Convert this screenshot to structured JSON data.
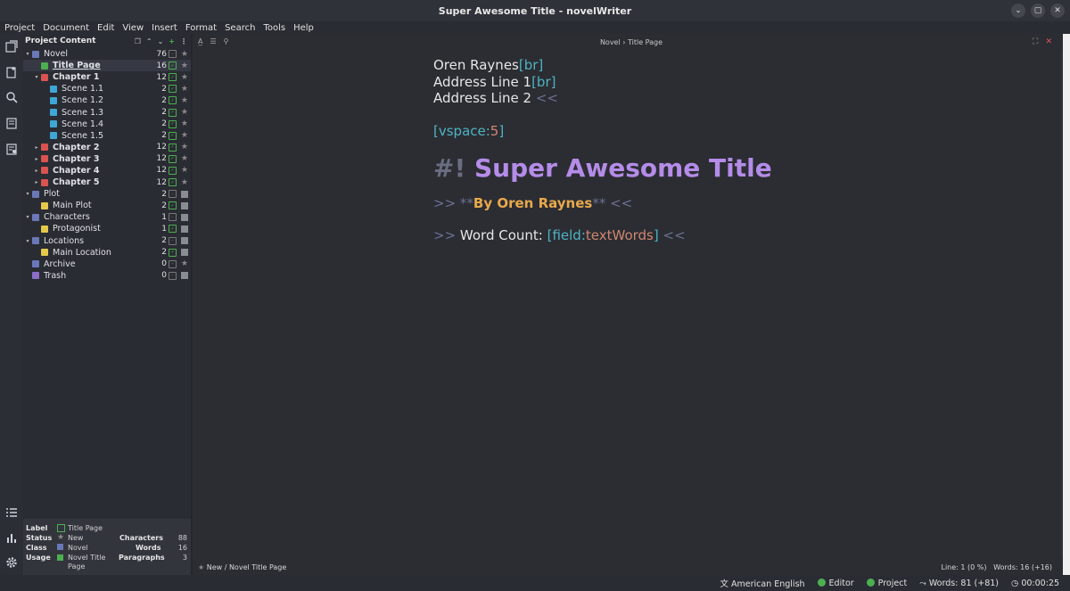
{
  "window": {
    "title": "Super Awesome Title - novelWriter",
    "controls": [
      "chevron-down-icon",
      "maximize-icon",
      "close-icon"
    ]
  },
  "menu": [
    "Project",
    "Document",
    "Edit",
    "View",
    "Insert",
    "Format",
    "Search",
    "Tools",
    "Help"
  ],
  "tree": {
    "header": "Project Content",
    "items": [
      {
        "name": "Novel",
        "count": "76",
        "color": "#6a78b8",
        "indent": 0,
        "bold": false
      },
      {
        "name": "Title Page",
        "count": "16",
        "color": "#4caf50",
        "indent": 1,
        "bold": true,
        "selected": true
      },
      {
        "name": "Chapter 1",
        "count": "12",
        "color": "#d9534f",
        "indent": 1,
        "bold": true
      },
      {
        "name": "Scene 1.1",
        "count": "2",
        "color": "#3fa7d6",
        "indent": 2,
        "bold": false
      },
      {
        "name": "Scene 1.2",
        "count": "2",
        "color": "#3fa7d6",
        "indent": 2,
        "bold": false
      },
      {
        "name": "Scene 1.3",
        "count": "2",
        "color": "#3fa7d6",
        "indent": 2,
        "bold": false
      },
      {
        "name": "Scene 1.4",
        "count": "2",
        "color": "#3fa7d6",
        "indent": 2,
        "bold": false
      },
      {
        "name": "Scene 1.5",
        "count": "2",
        "color": "#3fa7d6",
        "indent": 2,
        "bold": false
      },
      {
        "name": "Chapter 2",
        "count": "12",
        "color": "#d9534f",
        "indent": 1,
        "bold": true
      },
      {
        "name": "Chapter 3",
        "count": "12",
        "color": "#d9534f",
        "indent": 1,
        "bold": true
      },
      {
        "name": "Chapter 4",
        "count": "12",
        "color": "#d9534f",
        "indent": 1,
        "bold": true
      },
      {
        "name": "Chapter 5",
        "count": "12",
        "color": "#d9534f",
        "indent": 1,
        "bold": true
      },
      {
        "name": "Plot",
        "count": "2",
        "color": "#6a78b8",
        "indent": 0,
        "bold": false
      },
      {
        "name": "Main Plot",
        "count": "2",
        "color": "#e6c84b",
        "indent": 1,
        "bold": false
      },
      {
        "name": "Characters",
        "count": "1",
        "color": "#6a78b8",
        "indent": 0,
        "bold": false
      },
      {
        "name": "Protagonist",
        "count": "1",
        "color": "#e6c84b",
        "indent": 1,
        "bold": false
      },
      {
        "name": "Locations",
        "count": "2",
        "color": "#6a78b8",
        "indent": 0,
        "bold": false
      },
      {
        "name": "Main Location",
        "count": "2",
        "color": "#e6c84b",
        "indent": 1,
        "bold": false
      },
      {
        "name": "Archive",
        "count": "0",
        "color": "#6a78b8",
        "indent": 0,
        "bold": false
      },
      {
        "name": "Trash",
        "count": "0",
        "color": "#8a6ec8",
        "indent": 0,
        "bold": false
      }
    ]
  },
  "info": {
    "label_key": "Label",
    "label_val": "Title Page",
    "status_key": "Status",
    "status_val": "New",
    "class_key": "Class",
    "class_val": "Novel",
    "usage_key": "Usage",
    "usage_val": "Novel Title Page",
    "chars_key": "Characters",
    "chars_val": "88",
    "words_key": "Words",
    "words_val": "16",
    "paras_key": "Paragraphs",
    "paras_val": "3"
  },
  "editor": {
    "breadcrumb": "Novel  ›  Title Page",
    "line1_text": "Oren Raynes",
    "line1_cmd": "[br]",
    "line2_text": "Address Line 1",
    "line2_cmd": "[br]",
    "line3_text": "Address Line 2 ",
    "line3_end": "<<",
    "vspace_open": "[vspace:",
    "vspace_num": "5",
    "vspace_close": "]",
    "heading_hash": "#!",
    "heading_text": "Super Awesome Title",
    "center_open": ">> ",
    "star_open": "**",
    "author": "By Oren Raynes",
    "star_close": "**",
    "center_close": " <<",
    "wc_open": ">> ",
    "wc_label": "Word Count: ",
    "wc_field_open": "[field:",
    "wc_field_name": "textWords",
    "wc_field_close": "]",
    "wc_close": " <<",
    "footer_left": "New / Novel Title Page",
    "footer_right_line": "Line: 1 (0 %)",
    "footer_right_words": "Words: 16 (+16)"
  },
  "statusbar": {
    "language": "American English",
    "editor": "Editor",
    "project": "Project",
    "words": "Words: 81 (+81)",
    "timer": "00:00:25"
  }
}
